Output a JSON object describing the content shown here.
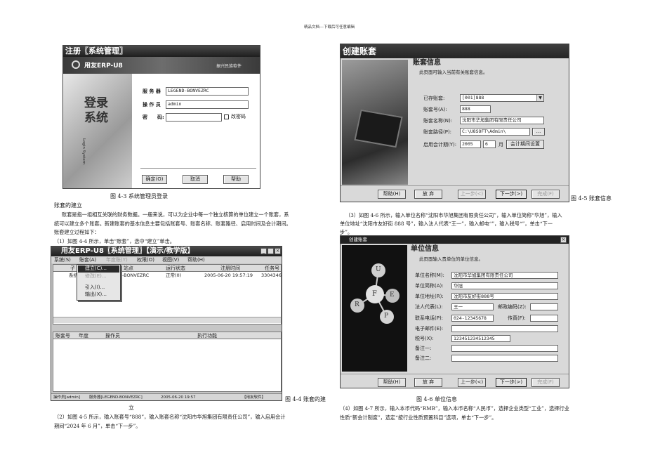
{
  "header": "精品文档---下载后可任意编辑",
  "login": {
    "title": "注册〖系统管理〗",
    "brand": "用友ERP-U8",
    "slogan": "振兴民族软件",
    "big": "登录系统",
    "sub": "Login System",
    "server_label": "服 务 器",
    "server_value": "LEGEND-BONVEZRC",
    "operator_label": "操 作 员",
    "operator_value": "admin",
    "password_label": "密　　码:",
    "change_pwd": "改密码",
    "ok": "确定(O)",
    "cancel": "取消",
    "help": "帮助"
  },
  "cap43": "图 4-3 系统管理员登录",
  "left_text": {
    "heading": "账套的建立",
    "p1a": "账套是指一组相互关联的财务数据。一般来说，可以为企业中每一个独立核算的单位建立一个账套，系",
    "p1b": "统可以建立多个账套。新建账套的基本信息主要包括账套号、账套名称、账套路径、启用时间及会计期间。",
    "p1c": "账套建立过程如下：",
    "step1": "（1）如图 4-4 所示，单击“账套”，选中“建立”单击。"
  },
  "main_win": {
    "title": "用友ERP-U8〖系统管理〗【演示/教学版】",
    "menu": [
      "系统(S)",
      "账套(A)",
      "年度账(Y)",
      "权限(O)",
      "视图(V)",
      "帮助(H)"
    ],
    "cols": [
      "子",
      "站点",
      "运行状态",
      "注册时间",
      "任务号"
    ],
    "row": [
      "系统",
      "-BONVEZRC",
      "正常(0)",
      "2005-06-20 19:57:19",
      "3304346"
    ],
    "dropdown": [
      "建立(C)...",
      "修改(E)...",
      "引入(I)...",
      "输出(X)..."
    ],
    "bottom_cols": [
      "账套号",
      "年度",
      "操作员",
      "执行功能"
    ],
    "status": [
      "操作员[admin]",
      "服务器[LEGEND-BONVEZRC]",
      "2005-06-20 19:57",
      "【用友软件】"
    ]
  },
  "cap44a": "图 4-4 账套的建",
  "cap44b": "立",
  "step2a": "（2）如图 4-5 所示，输入账套号“888”，输入账套名称“沈阳市华旭集团有限责任公司”，输入启用会计",
  "step2b": "期间“2024 年 6 月”，单击“下一步”。",
  "acct": {
    "title": "创建账套",
    "section": "账套信息",
    "desc": "此页面可输入当前有关账套信息。",
    "existing_label": "已存账套:",
    "existing_value": "[001]888",
    "no_label": "账套号(A):",
    "no_value": "888",
    "name_label": "账套名称(N):",
    "name_value": "沈阳市华旭集团有限责任公司",
    "path_label": "账套路径(P):",
    "path_value": "C:\\U8SOFT\\Admin\\",
    "period_label": "启用会计期(Y):",
    "year": "2005",
    "month": "6",
    "month_unit": "月",
    "period_btn": "会计期间设置",
    "browse": "...",
    "buttons": [
      "帮助(H)",
      "放 弃",
      "上一步(<)",
      "下一步(>)",
      "完成(F)"
    ]
  },
  "cap45": "图 4-5 账套信息",
  "step3a": "（3）如图 4-6 所示，输入单位名称“沈阳市华旭集团有限责任公司”，输入单位简称“华旭”，输入",
  "step3b": "单位地址“沈阳市友好街 888 号”，输入法人代表“王一”，输入邮电“”，输入税号“”，单击“下一",
  "step3c": "步”。",
  "unit": {
    "title": "创建账套",
    "section": "单位信息",
    "desc": "此页面输入贵单位的单位信息。",
    "fields": [
      {
        "label": "单位名称(M):",
        "value": "沈阳市华旭集团有限责任公司"
      },
      {
        "label": "单位简称(A):",
        "value": "华旭"
      },
      {
        "label": "单位地址(R):",
        "value": "沈阳市友好街888号"
      }
    ],
    "rep_label": "法人代表(L):",
    "rep_value": "王一",
    "zip_label": "邮政编码(Z):",
    "zip_value": "",
    "phone_label": "联系电话(P):",
    "phone_value": "024-12345678",
    "fax_label": "传真(F):",
    "fax_value": "",
    "email_label": "电子邮件(E):",
    "email_value": "",
    "tax_label": "税号(X):",
    "tax_value": "123451234512345",
    "note1_label": "备注一:",
    "note2_label": "备注二:",
    "letters": [
      "U",
      "F",
      "E",
      "R",
      "P"
    ],
    "buttons": [
      "帮助(H)",
      "放 弃",
      "上一步(<)",
      "下一步(>)",
      "完成(F)"
    ]
  },
  "cap46": "图 4-6 单位信息",
  "step4a": "（4）如图 4-7 所示，输入本币代码“RMB”，输入本币名称“人民币”，选择企业类型“工业”，选择行业",
  "step4b": "性质“新会计制度”，选定“按行业性质预置科目”选项，单击“下一步”。"
}
